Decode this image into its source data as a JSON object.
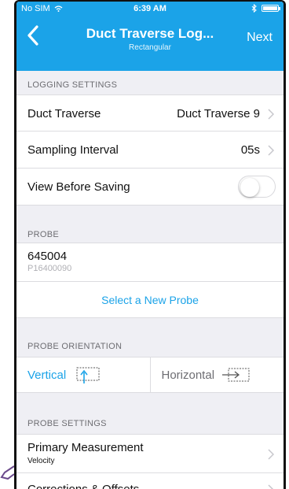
{
  "status_bar": {
    "carrier": "No SIM",
    "time": "6:39 AM"
  },
  "nav": {
    "title": "Duct Traverse Log...",
    "subtitle": "Rectangular",
    "next_label": "Next"
  },
  "logging_settings": {
    "header": "LOGGING SETTINGS",
    "duct_traverse": {
      "label": "Duct Traverse",
      "value": "Duct Traverse 9"
    },
    "sampling_interval": {
      "label": "Sampling Interval",
      "value": "05s"
    },
    "view_before_saving": {
      "label": "View Before Saving",
      "enabled": false
    }
  },
  "probe": {
    "header": "PROBE",
    "id": "645004",
    "serial": "P16400090",
    "select_label": "Select a New Probe"
  },
  "probe_orientation": {
    "header": "PROBE ORIENTATION",
    "options": [
      {
        "label": "Vertical",
        "selected": true
      },
      {
        "label": "Horizontal",
        "selected": false
      }
    ]
  },
  "probe_settings": {
    "header": "PROBE SETTINGS",
    "primary_measurement": {
      "label": "Primary Measurement",
      "value": "Velocity"
    },
    "corrections_label": "Corrections & Offsets"
  },
  "colors": {
    "accent": "#1ba3e8",
    "background": "#efeff4"
  },
  "icons": [
    "back-chevron-icon",
    "wifi-icon",
    "bluetooth-icon",
    "battery-icon",
    "chevron-right-icon",
    "vertical-probe-icon",
    "horizontal-probe-icon"
  ]
}
